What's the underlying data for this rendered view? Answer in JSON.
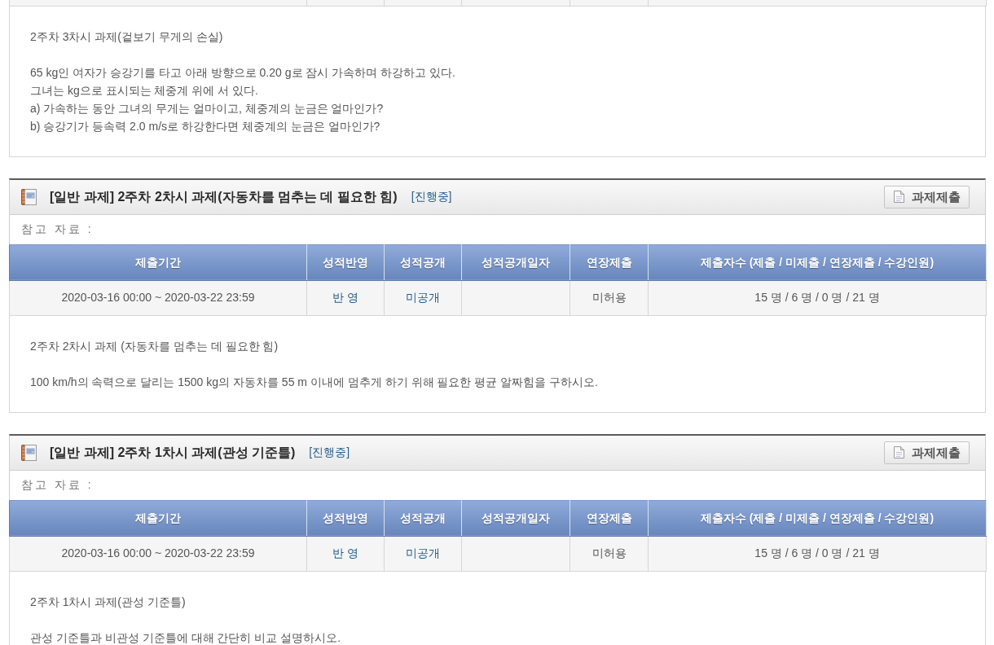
{
  "assignments": [
    {
      "table_cut_off": true,
      "description": {
        "title": "2주차 3차시 과제(겉보기 무게의 손실)",
        "body": [
          "65 kg인 여자가 승강기를 타고 아래 방향으로 0.20 g로 잠시 가속하며 하강하고 있다.",
          "그녀는 kg으로 표시되는 체중계 위에 서 있다.",
          "a) 가속하는 동안 그녀의 무게는 얼마이고, 체중계의 눈금은 얼마인가?",
          "b) 승강기가 등속력 2.0 m/s로 하강한다면 체중계의 눈금은 얼마인가?"
        ]
      }
    },
    {
      "title": "[일반 과제] 2주차 2차시 과제(자동차를 멈추는 데 필요한 힘)",
      "status": "[진행중]",
      "button": "과제제출",
      "reference_label": "참고 자료 :",
      "columns": [
        "제출기간",
        "성적반영",
        "성적공개",
        "성적공개일자",
        "연장제출",
        "제출자수 (제출 / 미제출 / 연장제출 / 수강인원)"
      ],
      "row": [
        {
          "kind": "text",
          "text": "2020-03-16 00:00 ~ 2020-03-22 23:59"
        },
        {
          "kind": "link",
          "text": "반 영"
        },
        {
          "kind": "link",
          "text": "미공개"
        },
        {
          "kind": "blank"
        },
        {
          "kind": "text",
          "text": "미허용"
        },
        {
          "kind": "text",
          "text": "15 명 / 6 명 / 0 명 / 21 명"
        }
      ],
      "description": {
        "title": "2주차 2차시 과제 (자동차를 멈추는 데 필요한 힘)",
        "body": [
          "100 km/h의 속력으로 달리는 1500 kg의 자동차를 55 m 이내에 멈추게 하기 위해 필요한 평균 알짜힘을 구하시오."
        ]
      }
    },
    {
      "title": "[일반 과제] 2주차 1차시 과제(관성 기준틀)",
      "status": "[진행중]",
      "button": "과제제출",
      "reference_label": "참고 자료 :",
      "columns": [
        "제출기간",
        "성적반영",
        "성적공개",
        "성적공개일자",
        "연장제출",
        "제출자수 (제출 / 미제출 / 연장제출 / 수강인원)"
      ],
      "row": [
        {
          "kind": "text",
          "text": "2020-03-16 00:00 ~ 2020-03-22 23:59"
        },
        {
          "kind": "link",
          "text": "반 영"
        },
        {
          "kind": "link",
          "text": "미공개"
        },
        {
          "kind": "blank"
        },
        {
          "kind": "text",
          "text": "미허용"
        },
        {
          "kind": "text",
          "text": "15 명 / 6 명 / 0 명 / 21 명"
        }
      ],
      "description": {
        "title": "2주차 1차시 과제(관성 기준틀)",
        "body": [
          "관성 기준틀과 비관성 기준틀에 대해 간단히 비교 설명하시오."
        ]
      }
    }
  ]
}
